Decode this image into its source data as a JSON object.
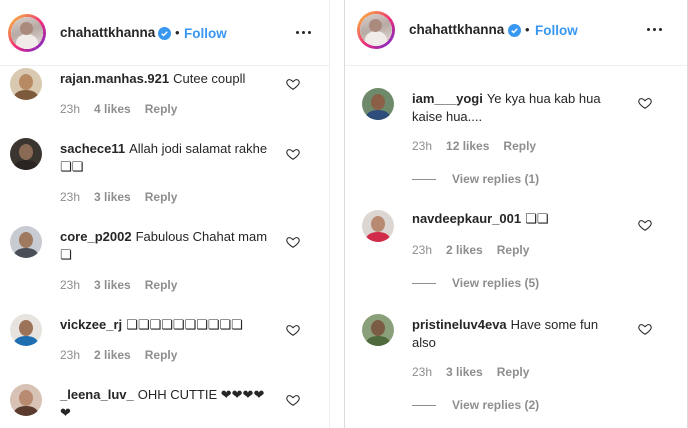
{
  "post": {
    "username": "chahattkhanna",
    "dot": "•",
    "follow_label": "Follow"
  },
  "left_comments": [
    {
      "username": "rajan.manhas.921",
      "text": "Cutee coupll",
      "time": "23h",
      "likes": "4 likes",
      "reply": "Reply"
    },
    {
      "username": "sachece11",
      "text": "Allah jodi salamat rakhe ❏❏",
      "time": "23h",
      "likes": "3 likes",
      "reply": "Reply"
    },
    {
      "username": "core_p2002",
      "text": "Fabulous Chahat mam ❏",
      "time": "23h",
      "likes": "3 likes",
      "reply": "Reply"
    },
    {
      "username": "vickzee_rj",
      "text": "❏❏❏❏❏❏❏❏❏❏",
      "time": "23h",
      "likes": "2 likes",
      "reply": "Reply"
    },
    {
      "username": "_leena_luv_",
      "text": "OHH CUTTIE ❤❤❤❤ ❤",
      "time": "",
      "likes": "",
      "reply": ""
    }
  ],
  "right_comments": [
    {
      "username": "iam___yogi",
      "text": "Ye kya hua kab hua kaise hua....",
      "time": "23h",
      "likes": "12 likes",
      "reply": "Reply",
      "view_replies": "View replies (1)"
    },
    {
      "username": "navdeepkaur_001",
      "text": "❏❏",
      "time": "23h",
      "likes": "2 likes",
      "reply": "Reply",
      "view_replies": "View replies (5)"
    },
    {
      "username": "pristineluv4eva",
      "text": "Have some fun also",
      "time": "23h",
      "likes": "3 likes",
      "reply": "Reply",
      "view_replies": "View replies (2)"
    }
  ],
  "colors": {
    "accent": "#3897f0",
    "secondary_text": "#8e8e8e",
    "primary_text": "#262626"
  }
}
